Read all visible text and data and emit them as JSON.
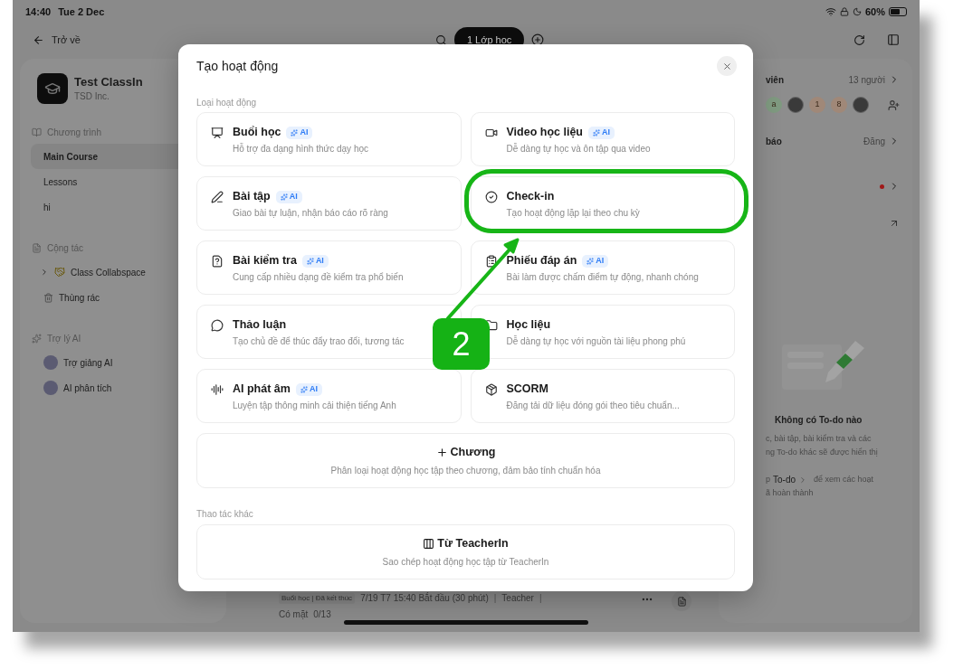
{
  "status_bar": {
    "time": "14:40",
    "date": "Tue 2 Dec",
    "battery": "60%"
  },
  "nav": {
    "back": "Trở về",
    "class_pill": "1 Lớp học"
  },
  "course": {
    "name": "Test ClassIn",
    "org": "TSD Inc."
  },
  "sidebar": {
    "sections": [
      {
        "title": "Chương trình",
        "items": [
          {
            "label": "Main Course",
            "selected": true
          },
          {
            "label": "Lessons",
            "selected": false
          },
          {
            "label": "hi",
            "selected": false
          }
        ]
      },
      {
        "title": "Cộng tác",
        "items": [
          {
            "label": "Class Collabspace",
            "selected": false
          },
          {
            "label": "Thùng rác",
            "selected": false
          }
        ]
      },
      {
        "title": "Trợ lý AI",
        "items": [
          {
            "label": "Trợ giảng AI",
            "selected": false
          },
          {
            "label": "AI phân tích",
            "selected": false
          }
        ]
      }
    ]
  },
  "activity_row": {
    "tag": "Buổi học | Đã kết thúc",
    "time": "7/19 T7 15:40 Bắt đầu (30 phút)",
    "teacher": "Teacher",
    "separator": "|",
    "attendance_label": "Có mặt",
    "attendance": "0/13"
  },
  "right_panel": {
    "members_title": "viên",
    "members_count": "13 người",
    "avatars": [
      {
        "kind": "letter",
        "text": "a",
        "color": "#7f9a80"
      },
      {
        "kind": "picture"
      },
      {
        "kind": "letter",
        "text": "1",
        "color": "#a08878"
      },
      {
        "kind": "letter",
        "text": "8",
        "color": "#a08878"
      },
      {
        "kind": "picture"
      }
    ],
    "notice_title": "báo",
    "notice_action": "Đăng",
    "todo": {
      "title": "Không có To-do nào",
      "lines": [
        "c, bài tập, bài kiểm tra và các",
        "ng To-do khác sẽ được hiển thị"
      ],
      "hint_prefix": "p",
      "hint_link": "To-do",
      "hint_rest": "để xem các hoạt",
      "hint_end": "ã hoàn thành"
    }
  },
  "modal": {
    "title": "Tạo hoạt động",
    "section_label": "Loại hoạt động",
    "activities": [
      {
        "title": "Buổi học",
        "badge": "AI",
        "description": "Hỗ trợ đa dạng hình thức dạy học",
        "annotated": false
      },
      {
        "title": "Video học liệu",
        "badge": "AI",
        "description": "Dễ dàng tự học và ôn tập qua video",
        "annotated": false
      },
      {
        "title": "Bài tập",
        "badge": "AI",
        "description": "Giao bài tự luận, nhận báo cáo rõ ràng",
        "annotated": false
      },
      {
        "title": "Check-in",
        "description": "Tạo hoạt động lặp lại theo chu kỳ",
        "annotated": true
      },
      {
        "title": "Bài kiểm tra",
        "badge": "AI",
        "description": "Cung cấp nhiều dạng đề kiểm tra phổ biến",
        "annotated": false
      },
      {
        "title": "Phiếu đáp án",
        "badge": "AI",
        "description": "Bài làm được chấm điểm tự động, nhanh chóng",
        "annotated": false
      },
      {
        "title": "Thảo luận",
        "description": "Tạo chủ đề để thúc đẩy trao đổi, tương tác",
        "annotated": false
      },
      {
        "title": "Học liệu",
        "description": "Dễ dàng tự học với nguồn tài liệu phong phú",
        "annotated": false
      },
      {
        "title": "AI phát âm",
        "badge": "AI",
        "description": "Luyện tập thông minh cải thiện tiếng Anh",
        "annotated": false
      },
      {
        "title": "SCORM",
        "description": "Đăng tải dữ liệu đóng gói theo tiêu chuẩn...",
        "annotated": false
      }
    ],
    "chapter": {
      "title": "Chương",
      "description": "Phân loại hoạt động học tập theo chương, đảm bảo tính chuẩn hóa"
    },
    "other_label": "Thao tác khác",
    "other_actions": [
      {
        "title": "Từ TeacherIn",
        "description": "Sao chép hoạt động học tập từ TeacherIn"
      }
    ]
  },
  "annotation": {
    "label": "2"
  }
}
